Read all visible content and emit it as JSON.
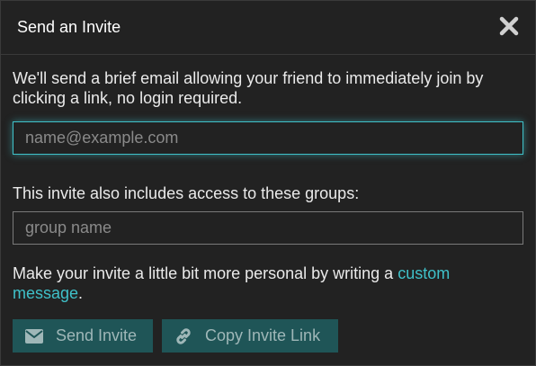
{
  "dialog": {
    "title": "Send an Invite",
    "description": "We'll send a brief email allowing your friend to immediately join by clicking a link, no login required.",
    "email_placeholder": "name@example.com",
    "groups_label": "This invite also includes access to these groups:",
    "group_placeholder": "group name",
    "personal_text_before": "Make your invite a little bit more personal by writing a ",
    "personal_link": "custom message",
    "personal_text_after": ".",
    "send_label": "Send Invite",
    "copy_label": "Copy Invite Link"
  },
  "icons": {
    "close": "close-icon",
    "send": "envelope-icon",
    "copy": "link-icon"
  },
  "colors": {
    "accent": "#3fc1c9",
    "button_bg": "#1f5557",
    "button_text": "#9fb7b8",
    "background": "#222222"
  }
}
